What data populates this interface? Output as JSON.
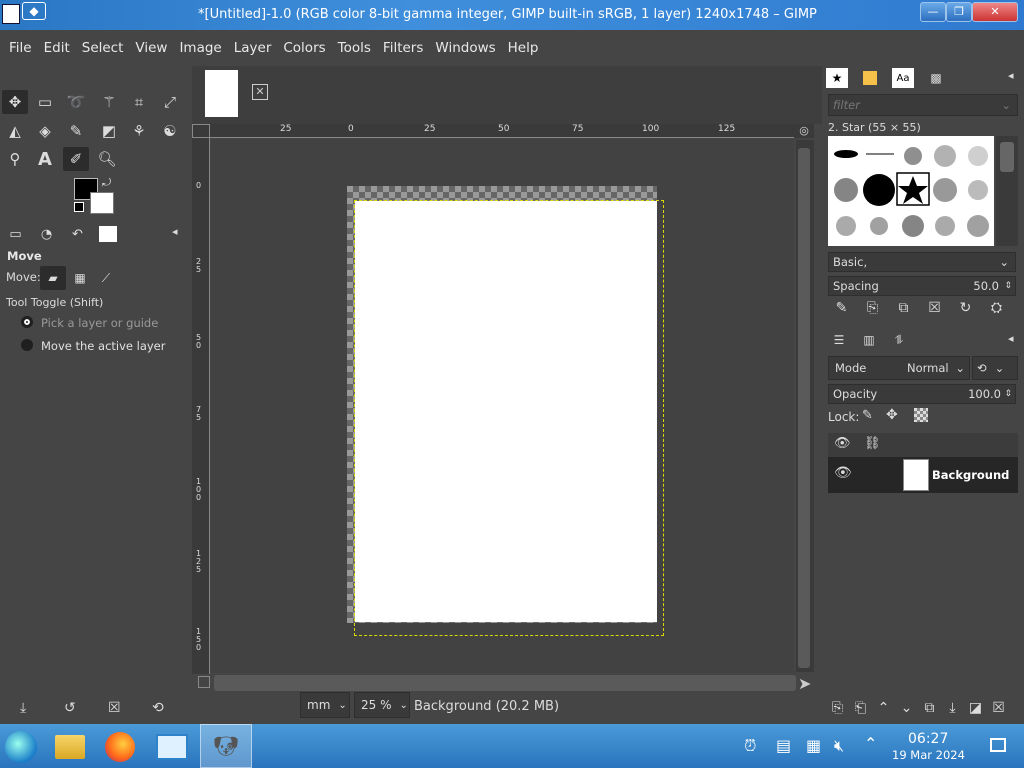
{
  "titlebar": {
    "title": "*[Untitled]-1.0 (RGB color 8-bit gamma integer, GIMP built-in sRGB, 1 layer) 1240x1748 – GIMP",
    "minimize": "—",
    "maximize": "❐",
    "close": "✕"
  },
  "menubar": {
    "items": [
      "File",
      "Edit",
      "Select",
      "View",
      "Image",
      "Layer",
      "Colors",
      "Tools",
      "Filters",
      "Windows",
      "Help"
    ]
  },
  "tool_options": {
    "title": "Move",
    "move_label": "Move:",
    "toggle_label": "Tool Toggle  (Shift)",
    "option_pick": "Pick a layer or guide",
    "option_move": "Move the active layer"
  },
  "rulers": {
    "h_ticks": [
      "25",
      "0",
      "25",
      "50",
      "75",
      "100",
      "125"
    ],
    "v_ticks": [
      "0",
      "2\n5",
      "5\n0",
      "7\n5",
      "1\n0\n0",
      "1\n2\n5",
      "1\n5\n0"
    ]
  },
  "statusbar": {
    "unit": "mm",
    "zoom": "25 %",
    "layer_info": "Background (20.2 MB)"
  },
  "brushes": {
    "filter_placeholder": "filter",
    "current_brush": "2. Star (55 × 55)",
    "tag": "Basic,",
    "spacing_label": "Spacing",
    "spacing_value": "50.0"
  },
  "layers": {
    "mode_label": "Mode",
    "mode_value": "Normal",
    "opacity_label": "Opacity",
    "opacity_value": "100.0",
    "lock_label": "Lock:",
    "layer_name": "Background"
  },
  "taskbar": {
    "time": "06:27",
    "date": "19 Mar 2024"
  }
}
